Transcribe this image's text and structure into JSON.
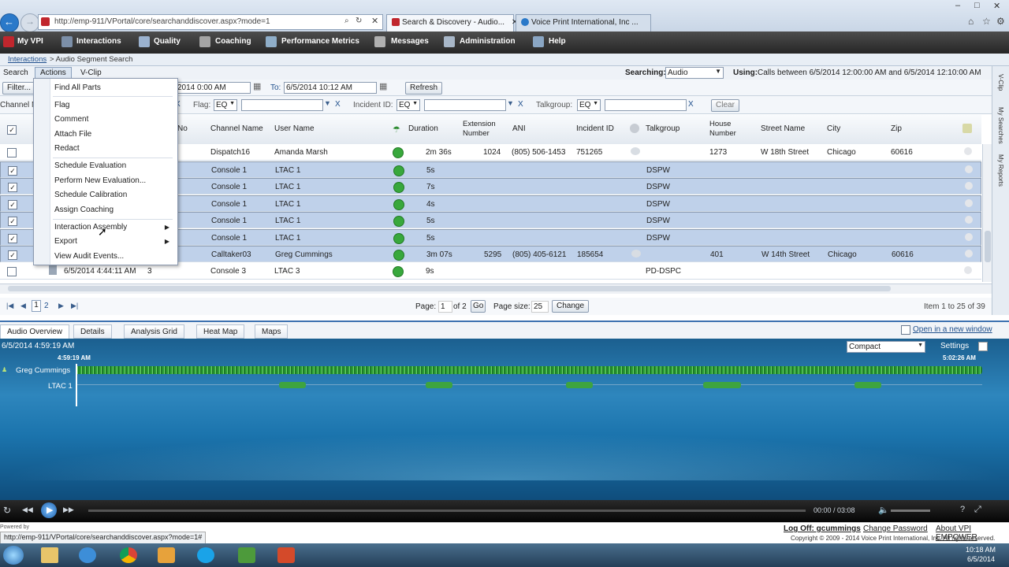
{
  "browser": {
    "url": "http://emp-911/VPortal/core/searchanddiscover.aspx?mode=1",
    "tabs": [
      "Search & Discovery - Audio...",
      "Voice Print International, Inc ..."
    ]
  },
  "nav": {
    "items": [
      "My VPI",
      "Interactions",
      "Quality",
      "Coaching",
      "Performance Metrics",
      "Messages",
      "Administration",
      "Help"
    ]
  },
  "breadcrumb": {
    "parent": "Interactions",
    "current": " > Audio Segment Search"
  },
  "toolbar": {
    "search": "Search",
    "actions": "Actions",
    "vclip": "V-Clip",
    "searching_label": "Searching:",
    "searching_value": "Audio",
    "using_label": "Using:",
    "using_text": "Calls between 6/5/2014 12:00:00 AM and 6/5/2014 12:10:00 AM"
  },
  "filters": {
    "filter_btn": "Filter...",
    "from_value": "2014 0:00 AM",
    "to_label": "To:",
    "to_value": "6/5/2014 10:12 AM",
    "refresh": "Refresh",
    "channel_label": "Channel N",
    "flag_label": "Flag:",
    "eq": "EQ",
    "incident_label": "Incident ID:",
    "talkgroup_label": "Talkgroup:",
    "clear": "Clear",
    "x": "X"
  },
  "grid": {
    "headers": {
      "no": "No",
      "channel": "Channel Name",
      "user": "User Name",
      "duration": "Duration",
      "ext1": "Extension",
      "ext2": "Number",
      "ani": "ANI",
      "incident": "Incident ID",
      "talkgroup": "Talkgroup",
      "house1": "House",
      "house2": "Number",
      "street": "Street Name",
      "city": "City",
      "zip": "Zip"
    },
    "rows": [
      {
        "checked": "",
        "channel": "Dispatch16",
        "user": "Amanda Marsh",
        "duration": "2m 36s",
        "ext": "1024",
        "ani": "(805) 506-1453",
        "incident": "751265",
        "talkgroup": "",
        "house": "1273",
        "street": "W 18th Street",
        "city": "Chicago",
        "zip": "60616",
        "sel": false
      },
      {
        "checked": "✓",
        "channel": "Console 1",
        "user": "LTAC 1",
        "duration": "5s",
        "ext": "",
        "ani": "",
        "incident": "",
        "talkgroup": "DSPW",
        "house": "",
        "street": "",
        "city": "",
        "zip": "",
        "sel": true
      },
      {
        "checked": "✓",
        "channel": "Console 1",
        "user": "LTAC 1",
        "duration": "7s",
        "ext": "",
        "ani": "",
        "incident": "",
        "talkgroup": "DSPW",
        "house": "",
        "street": "",
        "city": "",
        "zip": "",
        "sel": true
      },
      {
        "checked": "✓",
        "channel": "Console 1",
        "user": "LTAC 1",
        "duration": "4s",
        "ext": "",
        "ani": "",
        "incident": "",
        "talkgroup": "DSPW",
        "house": "",
        "street": "",
        "city": "",
        "zip": "",
        "sel": true
      },
      {
        "checked": "✓",
        "channel": "Console 1",
        "user": "LTAC 1",
        "duration": "5s",
        "ext": "",
        "ani": "",
        "incident": "",
        "talkgroup": "DSPW",
        "house": "",
        "street": "",
        "city": "",
        "zip": "",
        "sel": true
      },
      {
        "checked": "✓",
        "channel": "Console 1",
        "user": "LTAC 1",
        "duration": "5s",
        "ext": "",
        "ani": "",
        "incident": "",
        "talkgroup": "DSPW",
        "house": "",
        "street": "",
        "city": "",
        "zip": "",
        "sel": true
      },
      {
        "checked": "✓",
        "channel": "Calltaker03",
        "user": "Greg Cummings",
        "duration": "3m 07s",
        "ext": "5295",
        "ani": "(805) 405-6121",
        "incident": "185654",
        "talkgroup": "",
        "house": "401",
        "street": "W 14th Street",
        "city": "Chicago",
        "zip": "60616",
        "sel": true
      },
      {
        "checked": "",
        "date": "6/5/2014 4:44:11 AM",
        "no": "3",
        "channel": "Console 3",
        "user": "LTAC 3",
        "duration": "9s",
        "ext": "",
        "ani": "",
        "incident": "",
        "talkgroup": "PD-DSPC",
        "house": "",
        "street": "",
        "city": "",
        "zip": "",
        "sel": false
      }
    ]
  },
  "pager": {
    "p1": "1",
    "p2": "2",
    "page_label": "Page:",
    "page_value": "1",
    "of": "of 2",
    "go": "Go",
    "size_label": "Page size:",
    "size_value": "25",
    "change": "Change",
    "items": "Item 1 to 25 of 39"
  },
  "actions_menu": {
    "items": [
      "Find All Parts",
      "Flag",
      "Comment",
      "Attach File",
      "Redact",
      "Schedule Evaluation",
      "Perform New Evaluation...",
      "Schedule Calibration",
      "Assign Coaching",
      "Interaction Assembly",
      "Export",
      "View Audit Events..."
    ]
  },
  "bottom_tabs": [
    "Audio Overview",
    "Details",
    "Analysis Grid",
    "Heat Map",
    "Maps"
  ],
  "open_new_window": "Open in a new window",
  "audio": {
    "timestamp": "6/5/2014 4:59:19 AM",
    "view": "Compact",
    "settings": "Settings",
    "start": "4:59:19 AM",
    "end": "5:02:26 AM",
    "track1": "Greg Cummings",
    "track2": "LTAC 1"
  },
  "player": {
    "time": "00:00 / 03:08"
  },
  "footer": {
    "logoff": "Log Off: gcummings",
    "change_pw": "Change Password",
    "about": "About VPI EMPOWER",
    "copyright": "Copyright © 2009 - 2014 Voice Print International, Inc. All rights reserved.",
    "status_url": "http://emp-911/VPortal/core/searchanddiscover.aspx?mode=1#",
    "powered": "Powered by"
  },
  "rail": [
    "V-Clip",
    "My Searches",
    "My Reports"
  ],
  "taskbar": {
    "time": "10:18 AM",
    "date": "6/5/2014"
  }
}
